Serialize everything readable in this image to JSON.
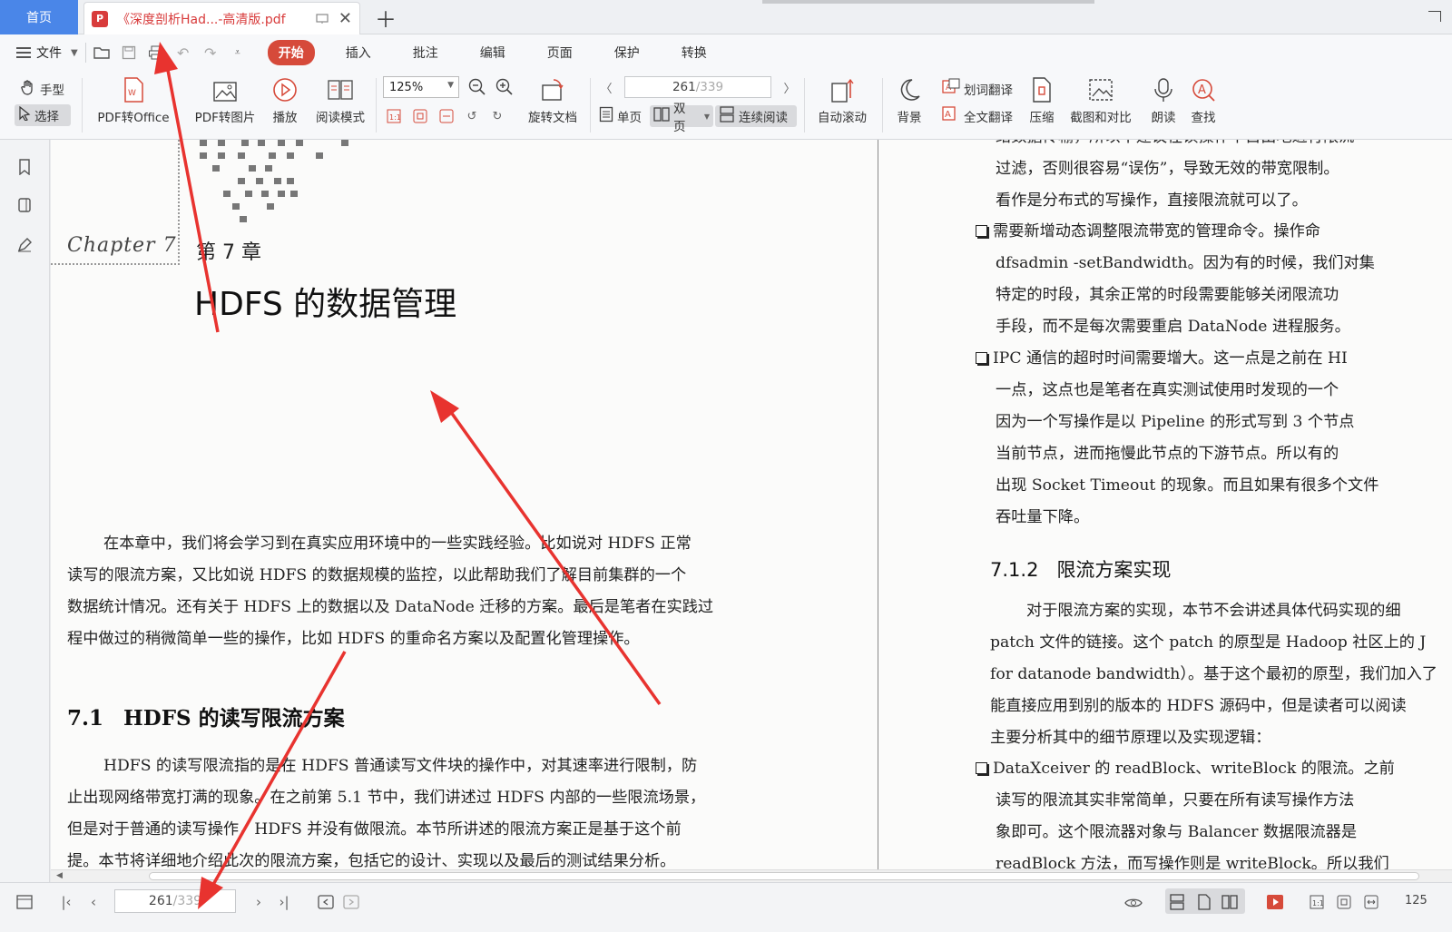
{
  "tabs": {
    "home": "首页",
    "doc_title": "《深度剖析Had...-高清版.pdf",
    "pdf_badge": "P"
  },
  "menu": {
    "file": "文件",
    "items": [
      "开始",
      "插入",
      "批注",
      "编辑",
      "页面",
      "保护",
      "转换"
    ]
  },
  "ribbon": {
    "hand": "手型",
    "select": "选择",
    "pdf_to_office": "PDF转Office",
    "pdf_to_image": "PDF转图片",
    "play": "播放",
    "read_mode": "阅读模式",
    "zoom": "125%",
    "rotate_doc": "旋转文档",
    "page_current": "261",
    "page_total": "/339",
    "single_page": "单页",
    "double_page": "双页",
    "continuous": "连续阅读",
    "auto_scroll": "自动滚动",
    "background": "背景",
    "word_translate": "划词翻译",
    "full_translate": "全文翻译",
    "compress": "压缩",
    "screenshot_compare": "截图和对比",
    "read_aloud": "朗读",
    "find": "查找"
  },
  "left_page": {
    "chapter_script": "Chapter 7",
    "chapter_label": "第 7 章",
    "chapter_title": "HDFS 的数据管理",
    "intro_lines": [
      "在本章中，我们将会学习到在真实应用环境中的一些实践经验。比如说对 HDFS 正常",
      "读写的限流方案，又比如说 HDFS 的数据规模的监控，以此帮助我们了解目前集群的一个",
      "数据统计情况。还有关于 HDFS 上的数据以及 DataNode 迁移的方案。最后是笔者在实践过",
      "程中做过的稍微简单一些的操作，比如 HDFS 的重命名方案以及配置化管理操作。"
    ],
    "section_num": "7.1",
    "section_title": "HDFS 的读写限流方案",
    "section_lines": [
      "HDFS 的读写限流指的是在 HDFS 普通读写文件块的操作中，对其速率进行限制，防",
      "止出现网络带宽打满的现象。在之前第 5.1 节中，我们讲述过 HDFS 内部的一些限流场景，",
      "但是对于普通的读写操作，HDFS 并没有做限流。本节所讲述的限流方案正是基于这个前",
      "提。本节将详细地介绍此次的限流方案，包括它的设计、实现以及最后的测试结果分析。"
    ]
  },
  "right_page": {
    "top_lines": [
      "络数据传输，所以不建议在读操作中自由地进行限流",
      "过滤，否则很容易“误伤”，导致无效的带宽限制。",
      "看作是分布式的写操作，直接限流就可以了。"
    ],
    "bullet1": [
      "需要新增动态调整限流带宽的管理命令。操作命",
      "dfsadmin -setBandwidth。因为有的时候，我们对集",
      "特定的时段，其余正常的时段需要能够关闭限流功",
      "手段，而不是每次需要重启 DataNode 进程服务。"
    ],
    "bullet2": [
      "IPC 通信的超时时间需要增大。这一点是之前在 HI",
      "一点，这点也是笔者在真实测试使用时发现的一个",
      "因为一个写操作是以 Pipeline 的形式写到 3 个节点",
      "当前节点，进而拖慢此节点的下游节点。所以有的",
      "出现 Socket Timeout 的现象。而且如果有很多个文件",
      "吞吐量下降。"
    ],
    "section_num": "7.1.2",
    "section_title": "限流方案实现",
    "impl_lines": [
      "对于限流方案的实现，本节不会讲述具体代码实现的细",
      "patch 文件的链接。这个 patch 的原型是 Hadoop 社区上的 J",
      "for datanode bandwidth）。基于这个最初的原型，我们加入了",
      "能直接应用到别的版本的 HDFS 源码中，但是读者可以阅读",
      "主要分析其中的细节原理以及实现逻辑："
    ],
    "bullet3": [
      "DataXceiver 的 readBlock、writeBlock 的限流。之前",
      "读写的限流其实非常简单，只要在所有读写操作方法",
      "象即可。这个限流器对象与 Balancer 数据限流器是",
      "readBlock 方法，而写操作则是 writeBlock。所以我们"
    ]
  },
  "status": {
    "page_current": "261",
    "page_total": "/339",
    "zoom": "125"
  },
  "colors": {
    "accent": "#d64a3a",
    "home_tab": "#4a86e8",
    "arrow": "#e8332f"
  }
}
